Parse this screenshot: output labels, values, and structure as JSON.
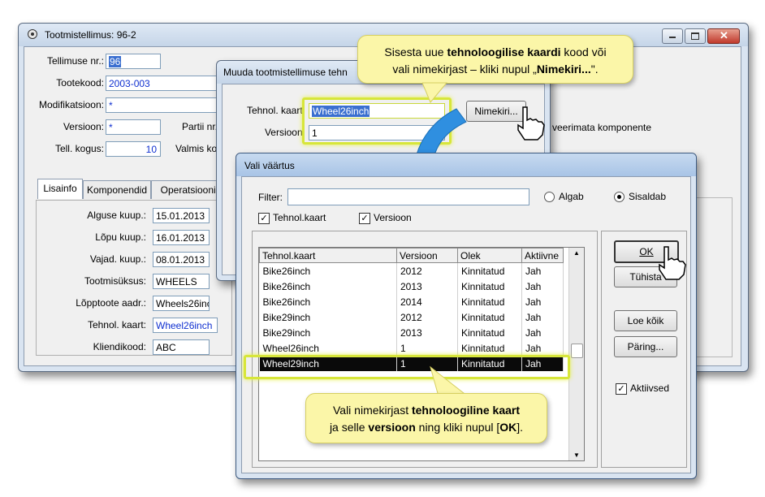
{
  "main_window": {
    "title": "Tootmistellimus: 96-2",
    "fields": {
      "tellimuse_nr": {
        "label": "Tellimuse nr.:",
        "value": "96"
      },
      "tootekood": {
        "label": "Tootekood:",
        "value": "2003-003"
      },
      "modifikatsioon": {
        "label": "Modifikatsioon:",
        "value": "*"
      },
      "versioon": {
        "label": "Versioon:",
        "value": "*"
      },
      "partii_label": "Partii nr.",
      "tell_kogus": {
        "label": "Tell. kogus:",
        "value": "10"
      },
      "valmis_label": "Valmis ko"
    },
    "tabs": [
      "Lisainfo",
      "Komponendid",
      "Operatsioonid"
    ],
    "lisainfo": {
      "alguse_kuup": {
        "label": "Alguse kuup.:",
        "value": "15.01.2013"
      },
      "lopu_kuup": {
        "label": "Lõpu kuup.:",
        "value": "16.01.2013"
      },
      "vajad_kuup": {
        "label": "Vajad. kuup.:",
        "value": "08.01.2013"
      },
      "tootmisuksus": {
        "label": "Tootmisüksus:",
        "value": "WHEELS"
      },
      "lopptoote_aadr": {
        "label": "Lõpptoote aadr.:",
        "value": "Wheels26inc"
      },
      "tehnol_kaart": {
        "label": "Tehnol. kaart:",
        "value": "Wheel26inch"
      },
      "kliendikood": {
        "label": "Kliendikood:",
        "value": "ABC"
      }
    },
    "right_text": "veerimata komponente"
  },
  "change_dialog": {
    "title": "Muuda tootmistellimuse tehn",
    "tehnol_kaart": {
      "label": "Tehnol. kaart:",
      "value": "Wheel26inch"
    },
    "versioon": {
      "label": "Versioon:",
      "value": "1"
    },
    "nimekiri_button": "Nimekiri..."
  },
  "select_dialog": {
    "title": "Vali väärtus",
    "filter_label": "Filter:",
    "filter_value": "",
    "radio_algab": "Algab",
    "radio_sisaldab": "Sisaldab",
    "cb_tehnol": "Tehnol.kaart",
    "cb_versioon": "Versioon",
    "columns": [
      "Tehnol.kaart",
      "Versioon",
      "Olek",
      "Aktiivne"
    ],
    "rows": [
      [
        "Bike26inch",
        "2012",
        "Kinnitatud",
        "Jah"
      ],
      [
        "Bike26inch",
        "2013",
        "Kinnitatud",
        "Jah"
      ],
      [
        "Bike26inch",
        "2014",
        "Kinnitatud",
        "Jah"
      ],
      [
        "Bike29inch",
        "2012",
        "Kinnitatud",
        "Jah"
      ],
      [
        "Bike29inch",
        "2013",
        "Kinnitatud",
        "Jah"
      ],
      [
        "Wheel26inch",
        "1",
        "Kinnitatud",
        "Jah"
      ],
      [
        "Wheel29inch",
        "1",
        "Kinnitatud",
        "Jah"
      ]
    ],
    "buttons": {
      "ok": "OK",
      "tuhista": "Tühista",
      "loe_koik": "Loe kõik",
      "paring": "Päring..."
    },
    "aktiivsed_label": "Aktiivsed"
  },
  "callout_top": {
    "line1_a": "Sisesta uue ",
    "line1_b": "tehnoloogilise kaardi",
    "line1_c": " kood või",
    "line2_a": "vali nimekirjast – kliki nupul „",
    "line2_b": "Nimekiri...",
    "line2_c": "\"."
  },
  "callout_bottom": {
    "line1_a": "Vali nimekirjast ",
    "line1_b": "tehnoloogiline kaart",
    "line2_a": "ja selle ",
    "line2_b": "versioon",
    "line2_c": " ning kliki nupul  [",
    "line2_d": "OK",
    "line2_e": "]."
  },
  "colors": {
    "highlight": "#d7e63a",
    "callout_bg": "#fbf6a8",
    "arrow": "#2f8fe0"
  }
}
